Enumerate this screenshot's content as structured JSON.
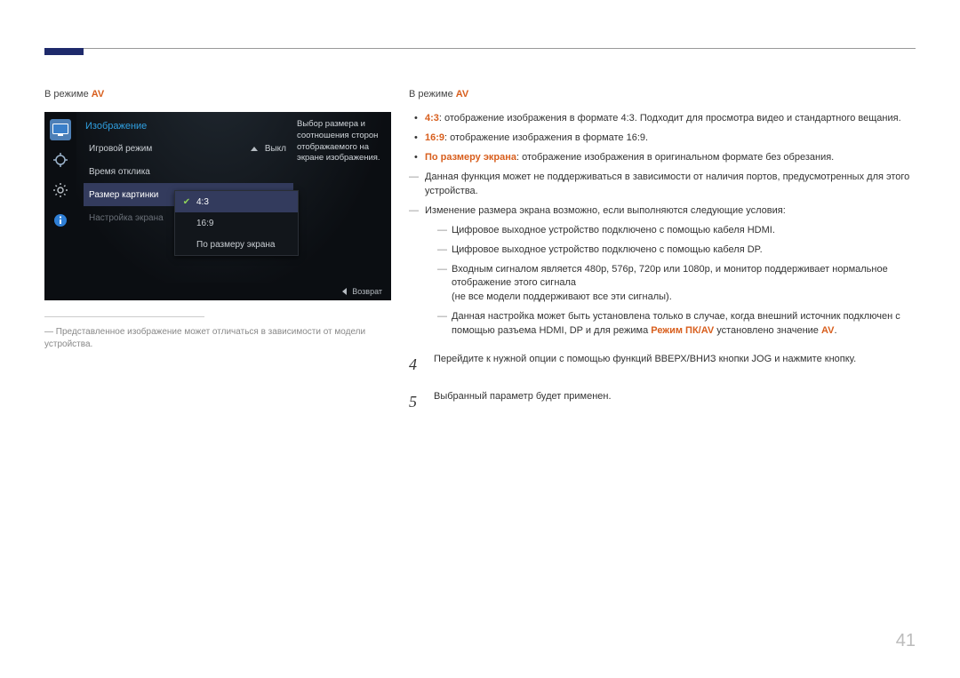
{
  "header": {
    "mode_prefix": "В режиме ",
    "mode_suffix": "AV"
  },
  "osd": {
    "title": "Изображение",
    "icons": [
      "monitor-icon",
      "target-icon",
      "gear-icon",
      "info-icon"
    ],
    "rows": [
      {
        "label": "Игровой режим",
        "value": "Выкл"
      },
      {
        "label": "Время отклика",
        "value": ""
      },
      {
        "label": "Размер картинки",
        "value": ""
      },
      {
        "label": "Настройка экрана",
        "value": ""
      }
    ],
    "submenu": [
      "4:3",
      "16:9",
      "По размеру экрана"
    ],
    "desc": "Выбор размера и соотношения сторон отображаемого на экране изображения.",
    "footer": "Возврат"
  },
  "footnote_prefix": "― ",
  "footnote": "Представленное изображение может отличаться в зависимости от модели устройства.",
  "bullets": [
    {
      "bold": "4:3",
      "text": ": отображение изображения в формате 4:3. Подходит для просмотра видео и стандартного вещания."
    },
    {
      "bold": "16:9",
      "text": ": отображение изображения в формате 16:9."
    },
    {
      "bold": "По размеру экрана",
      "text": ": отображение изображения в оригинальном формате без обрезания."
    }
  ],
  "notes": {
    "n1": "Данная функция может не поддерживаться в зависимости от наличия портов, предусмотренных для этого устройства.",
    "n2": "Изменение размера экрана возможно, если выполняются следующие условия:",
    "sub1": "Цифровое выходное устройство подключено с помощью кабеля HDMI.",
    "sub2": "Цифровое выходное устройство подключено с помощью кабеля DP.",
    "sub3_a": "Входным сигналом является 480p, 576p, 720p или 1080p, и монитор поддерживает нормальное отображение этого сигнала",
    "sub3_b": "(не все модели поддерживают все эти сигналы).",
    "sub4_a": "Данная настройка может быть установлена только в случае, когда внешний источник подключен с помощью разъема HDMI, DP и для режима ",
    "sub4_hl1": "Режим ПК/AV",
    "sub4_mid": " установлено значение ",
    "sub4_hl2": "AV",
    "sub4_end": "."
  },
  "steps": {
    "s4_num": "4",
    "s4": "Перейдите к нужной опции с помощью функций ВВЕРХ/ВНИЗ кнопки JOG и нажмите кнопку.",
    "s5_num": "5",
    "s5": "Выбранный параметр будет применен."
  },
  "page_number": "41"
}
